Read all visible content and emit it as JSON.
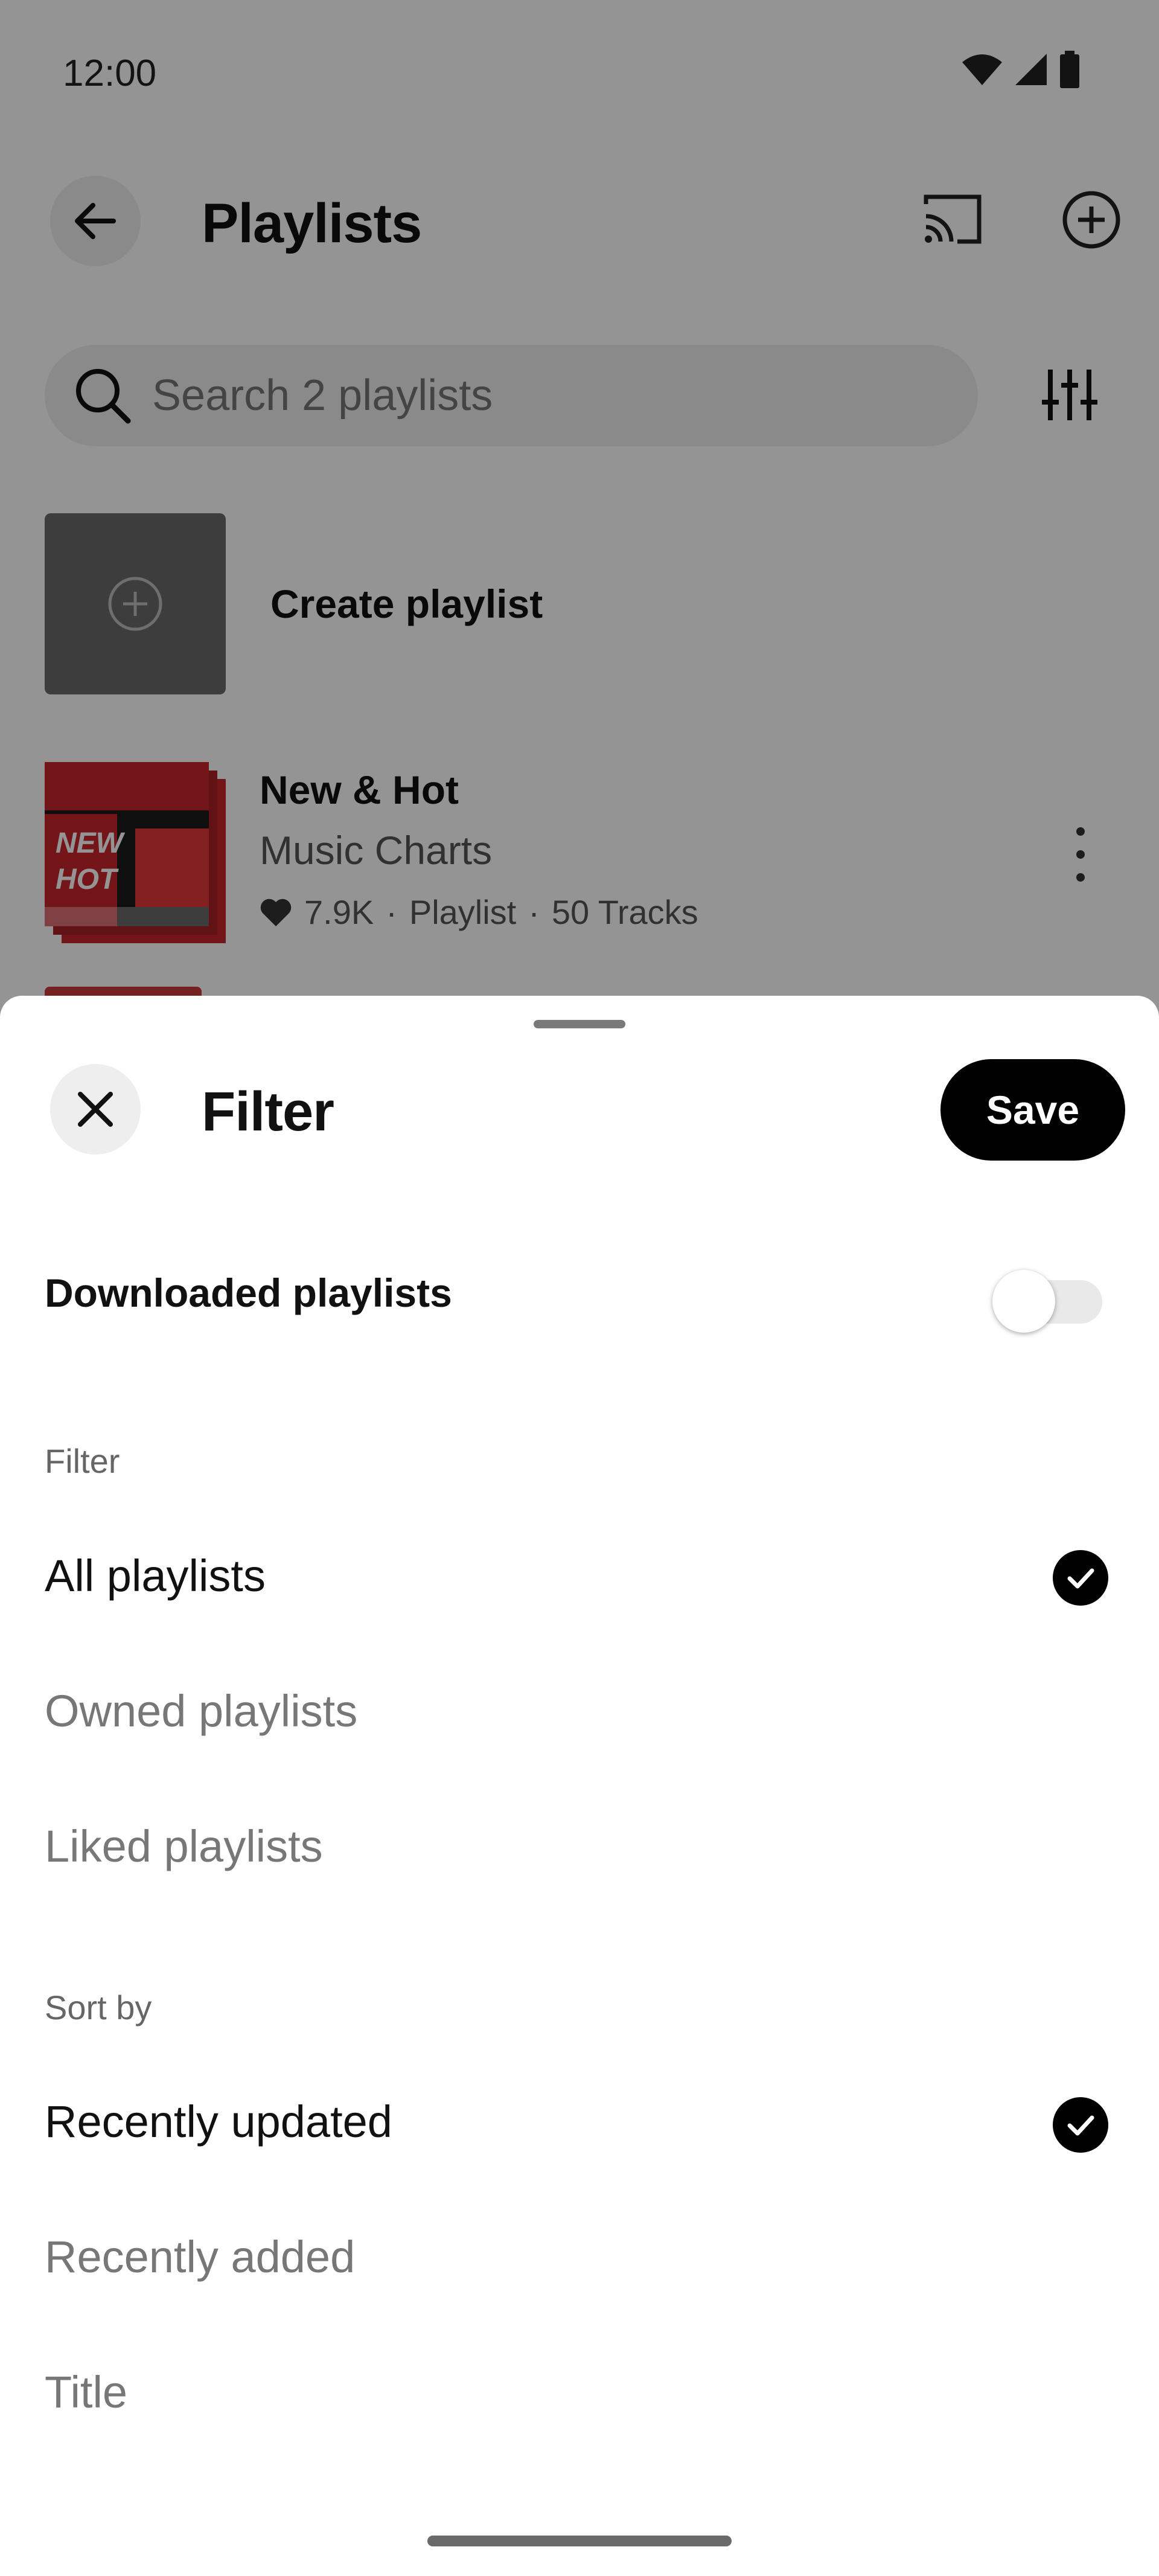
{
  "status_bar": {
    "time": "12:00"
  },
  "header": {
    "title": "Playlists",
    "back_icon": "arrow-left-icon",
    "cast_icon": "cast-icon",
    "add_icon": "plus-circle-icon"
  },
  "search": {
    "placeholder": "Search 2 playlists",
    "filter_icon": "sliders-icon"
  },
  "create_playlist": {
    "label": "Create playlist"
  },
  "playlists": [
    {
      "title": "New & Hot",
      "subtitle": "Music Charts",
      "likes": "7.9K",
      "type": "Playlist",
      "tracks": "50 Tracks",
      "separator": "·",
      "art_text": "NEW & HOT",
      "art_colors": [
        "#c8262c",
        "#1a1a1a",
        "#e23a3a"
      ]
    }
  ],
  "sheet": {
    "title": "Filter",
    "save_label": "Save",
    "downloaded_label": "Downloaded playlists",
    "downloaded_enabled": false,
    "filter_section": "Filter",
    "filter_options": [
      {
        "label": "All playlists",
        "selected": true
      },
      {
        "label": "Owned playlists",
        "selected": false
      },
      {
        "label": "Liked playlists",
        "selected": false
      }
    ],
    "sort_section": "Sort by",
    "sort_options": [
      {
        "label": "Recently updated",
        "selected": true
      },
      {
        "label": "Recently added",
        "selected": false
      },
      {
        "label": "Title",
        "selected": false
      }
    ]
  },
  "colors": {
    "scrim": "rgba(0,0,0,0.42)",
    "accent": "#000000",
    "selected_text": "#111111",
    "unselected_text": "#777777"
  }
}
